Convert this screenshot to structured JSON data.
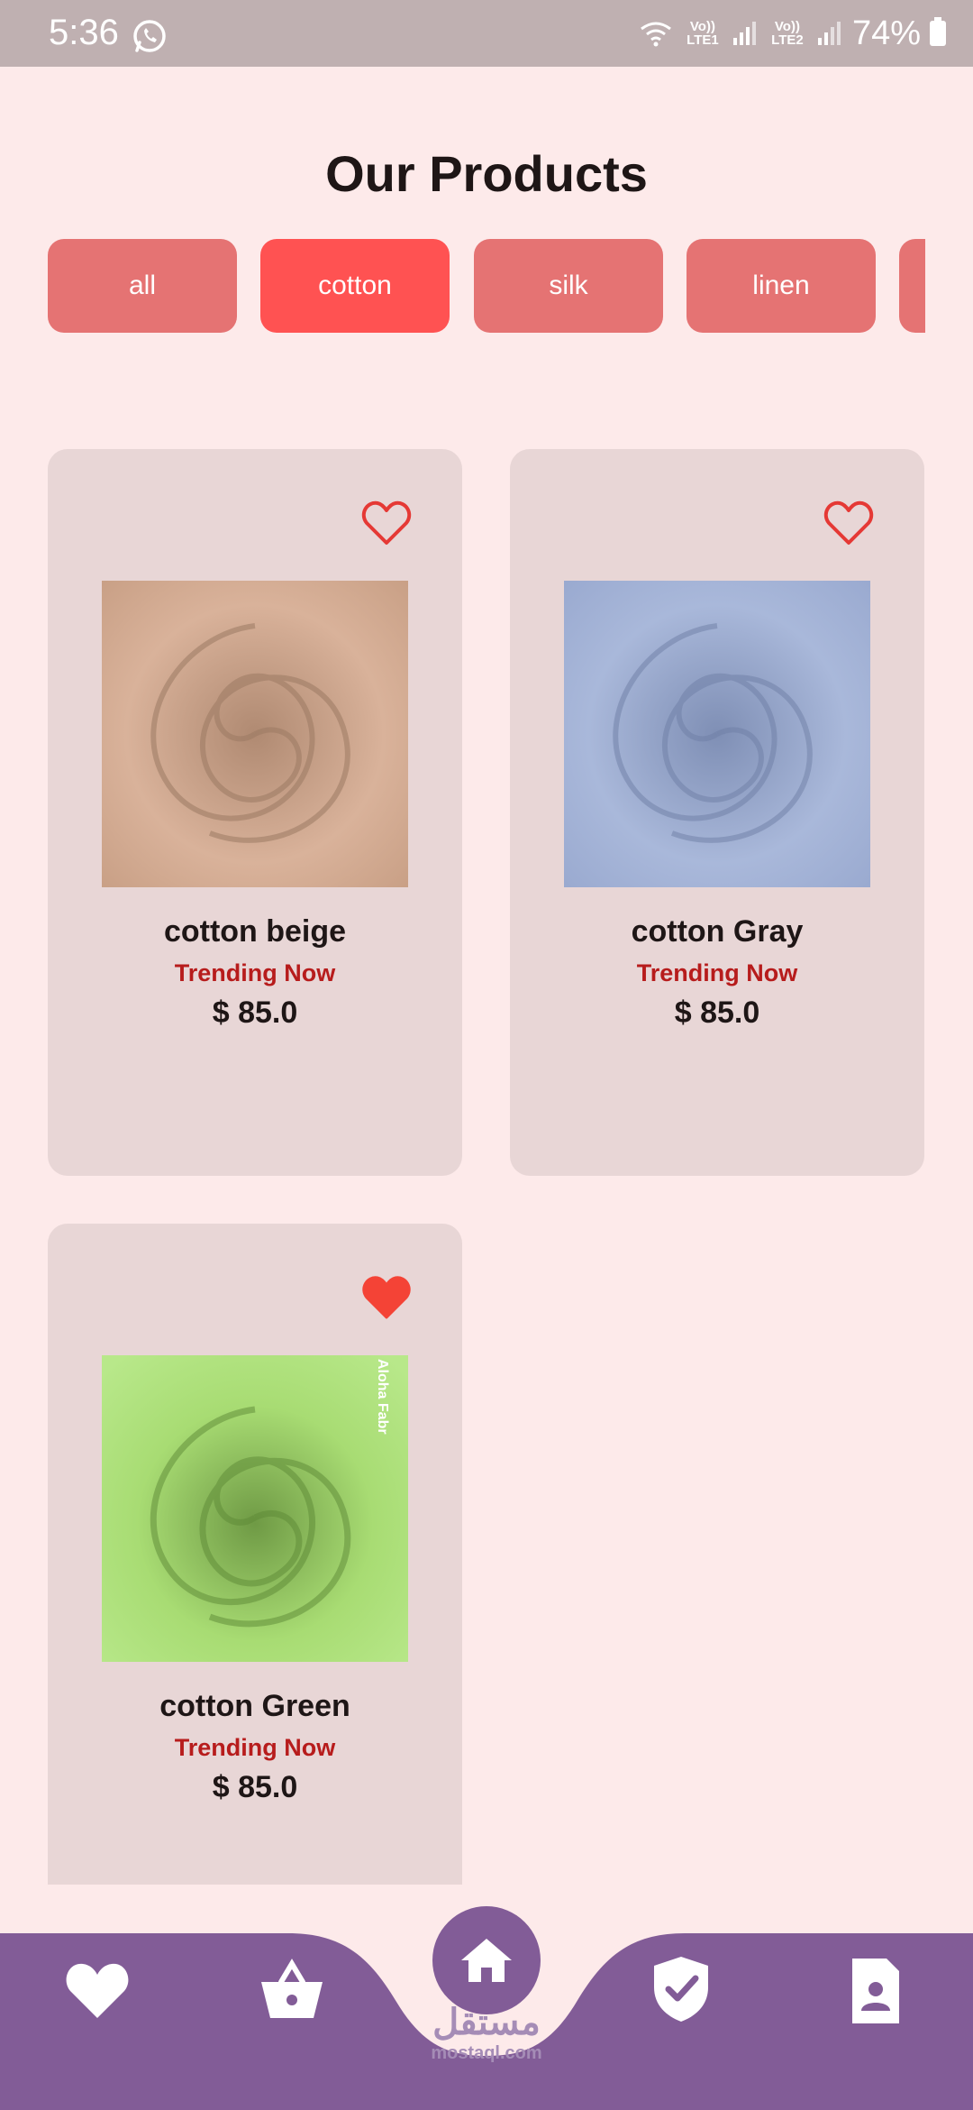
{
  "status_bar": {
    "time": "5:36",
    "sim1": "Vo)) LTE1",
    "sim2": "Vo)) LTE2",
    "battery": "74%"
  },
  "page": {
    "title": "Our Products"
  },
  "categories": [
    {
      "label": "all",
      "active": false
    },
    {
      "label": "cotton",
      "active": true
    },
    {
      "label": "silk",
      "active": false
    },
    {
      "label": "linen",
      "active": false
    },
    {
      "label": "",
      "active": false
    }
  ],
  "products": [
    {
      "name": "cotton beige",
      "tag": "Trending Now",
      "price": "$ 85.0",
      "favorite": false,
      "fabric_color": "#d9b29a"
    },
    {
      "name": "cotton Gray",
      "tag": "Trending Now",
      "price": "$ 85.0",
      "favorite": false,
      "fabric_color": "#a9b8da"
    },
    {
      "name": "cotton Green",
      "tag": "Trending Now",
      "price": "$ 85.0",
      "favorite": true,
      "fabric_color": "#a8dc73",
      "image_text": "Aloha Fabr"
    }
  ],
  "bottom_nav": {
    "items": [
      "heart-icon",
      "basket-icon",
      "home-icon",
      "shield-check-icon",
      "profile-document-icon"
    ],
    "active": "home-icon"
  },
  "watermark": {
    "arabic": "مستقل",
    "latin": "mostaql.com"
  },
  "colors": {
    "background": "#fdeaea",
    "chip": "#e57373",
    "chip_active": "#ff5252",
    "card": "#e8d6d6",
    "nav": "#825c97",
    "accent_red": "#e53935",
    "trending": "#b71c1c"
  }
}
